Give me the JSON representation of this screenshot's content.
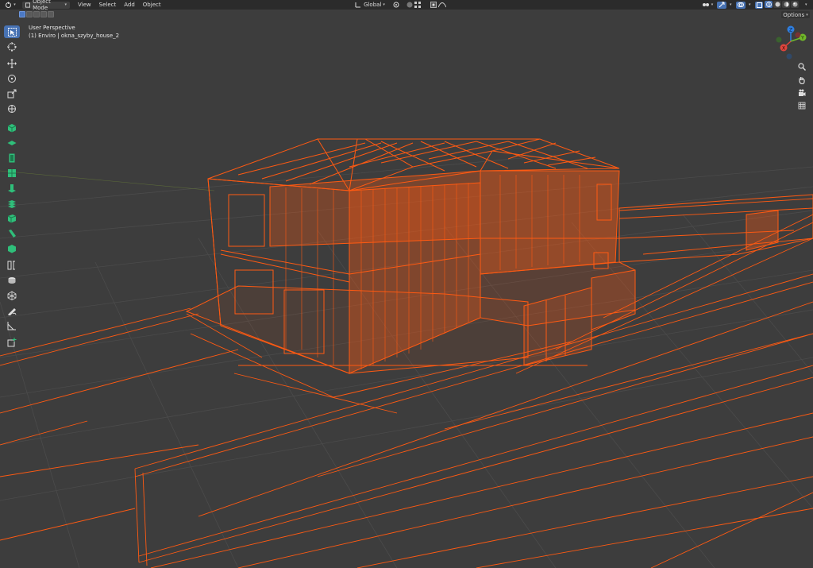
{
  "header": {
    "editor_type_icon": "cube-editor-icon",
    "mode_label": "Object Mode",
    "menus": [
      "View",
      "Select",
      "Add",
      "Object"
    ],
    "transform_orientation": "Global",
    "pivot_icon": "pivot-icon",
    "snap_icon": "snap-icon",
    "proportional_icon": "proportional-icon",
    "visibility_icon": "visibility-icon",
    "gizmo_icon": "gizmo-icon",
    "overlay_icon": "overlay-icon",
    "xray_icon": "xray-icon",
    "shading_modes": [
      "wireframe",
      "solid",
      "material",
      "rendered"
    ],
    "active_shading": "wireframe"
  },
  "subheader": {
    "options_label": "Options",
    "select_modes": [
      "new",
      "extend",
      "subtract",
      "invert",
      "intersect"
    ]
  },
  "overlay": {
    "view_name": "User Perspective",
    "object_info": "(1) Enviro | okna_szyby_house_2"
  },
  "toolbar": {
    "tools": [
      {
        "name": "select-box",
        "active": true
      },
      {
        "name": "cursor",
        "active": false
      },
      {
        "name": "move",
        "active": false
      },
      {
        "name": "rotate",
        "active": false
      },
      {
        "name": "scale",
        "active": false
      },
      {
        "name": "transform",
        "active": false
      },
      {
        "name": "add-cube",
        "active": false
      },
      {
        "name": "add-plane",
        "active": false
      },
      {
        "name": "add-door",
        "active": false
      },
      {
        "name": "add-window",
        "active": false
      },
      {
        "name": "add-column",
        "active": false
      },
      {
        "name": "add-stairs",
        "active": false
      },
      {
        "name": "add-wall",
        "active": false
      },
      {
        "name": "add-beam",
        "active": false
      },
      {
        "name": "add-slab",
        "active": false
      },
      {
        "name": "measure-bool",
        "active": false
      },
      {
        "name": "cylinder-tool",
        "active": false
      },
      {
        "name": "mesh-tool",
        "active": false
      },
      {
        "name": "annotate",
        "active": false
      },
      {
        "name": "measure",
        "active": false
      },
      {
        "name": "add-object",
        "active": false
      }
    ]
  },
  "nav_gizmo": {
    "axes": [
      {
        "label": "Z",
        "color": "#2f7fe0"
      },
      {
        "label": "Y",
        "color": "#71b82a"
      },
      {
        "label": "X",
        "color": "#e0453d"
      }
    ]
  },
  "nav_buttons": [
    "zoom-icon",
    "hand-icon",
    "camera-icon",
    "grid-icon"
  ],
  "colors": {
    "viewport": "#3d3d3d",
    "header": "#2b2b2b",
    "selection": "#ff5a12",
    "grid": "#4a4a4a",
    "active_tool": "#4772b3",
    "tool_green": "#2fbf7a"
  }
}
